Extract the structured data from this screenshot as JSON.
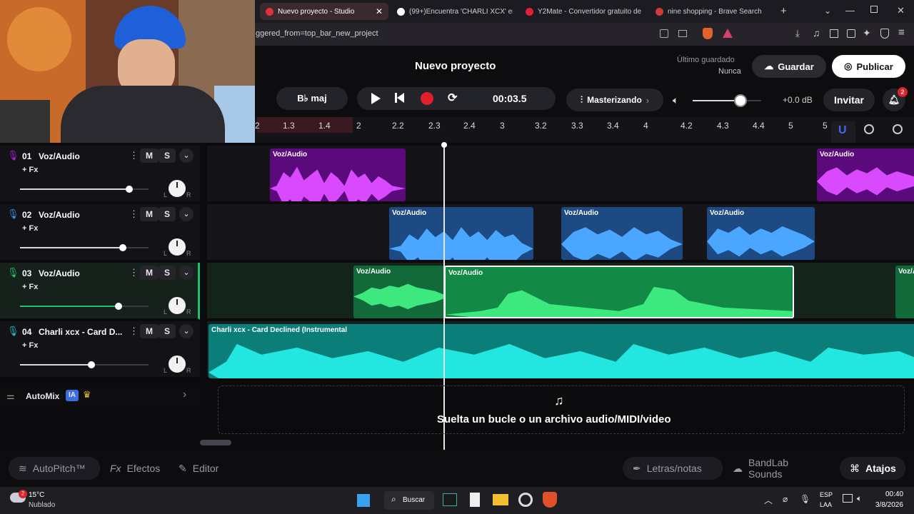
{
  "browser": {
    "tabs": [
      {
        "label": "Nuevo proyecto - Studio",
        "active": true
      },
      {
        "label": "(99+)Encuentra 'CHARLI XCX' en",
        "active": false
      },
      {
        "label": "Y2Mate - Convertidor gratuito de",
        "active": false
      },
      {
        "label": "nine shopping - Brave Search",
        "active": false
      }
    ],
    "url": "ggered_from=top_bar_new_project"
  },
  "app": {
    "project_title": "Nuevo proyecto",
    "last_saved_label": "Último guardado",
    "last_saved_value": "Nunca",
    "save_label": "Guardar",
    "publish_label": "Publicar",
    "key_label": "B♭ maj",
    "time": "00:03.5",
    "mastering_label": "Masterizando",
    "volume_db": "+0.0 dB",
    "invite_label": "Invitar",
    "notifications_count": "2"
  },
  "ruler": {
    "ticks": [
      "2",
      "1.3",
      "1.4",
      "2",
      "2.2",
      "2.3",
      "2.4",
      "3",
      "3.2",
      "3.3",
      "3.4",
      "4",
      "4.2",
      "4.3",
      "4.4",
      "5",
      "5"
    ]
  },
  "tracks": [
    {
      "number": "01",
      "name": "Voz/Audio",
      "fx": "+ Fx",
      "color": "#b41ee0",
      "volume": 0.8
    },
    {
      "number": "02",
      "name": "Voz/Audio",
      "fx": "+ Fx",
      "color": "#3f8fe8",
      "volume": 0.75
    },
    {
      "number": "03",
      "name": "Voz/Audio",
      "fx": "+ Fx",
      "color": "#22c06a",
      "volume": 0.72
    },
    {
      "number": "04",
      "name": "Charli xcx - Card D...",
      "fx": "+ Fx",
      "color": "#14c6c0",
      "volume": 0.52
    }
  ],
  "track_controls": {
    "mute": "M",
    "solo": "S",
    "pan_left": "L",
    "pan_right": "R"
  },
  "clips": {
    "voz": "Voz/Audio",
    "instrumental": "Charli xcx - Card Declined (Instrumental"
  },
  "automix": {
    "label": "AutoMix",
    "badge": "IA"
  },
  "drop_zone": "Suelta un bucle o un archivo audio/MIDI/video",
  "bottom_bar": {
    "autopitch": "AutoPitch™",
    "effects_prefix": "Fx",
    "effects": "Efectos",
    "editor": "Editor",
    "lyrics": "Letras/notas",
    "sounds": "BandLab Sounds",
    "shortcuts": "Atajos"
  },
  "taskbar": {
    "weather_temp": "15°C",
    "weather_desc": "Nublado",
    "weather_badge": "2",
    "search": "Buscar",
    "lang1": "ESP",
    "lang2": "LAA",
    "time": "00:40",
    "date": "3/8/2026"
  },
  "colors": {
    "record": "#e0202a",
    "accent_blue": "#3b6fe0"
  }
}
